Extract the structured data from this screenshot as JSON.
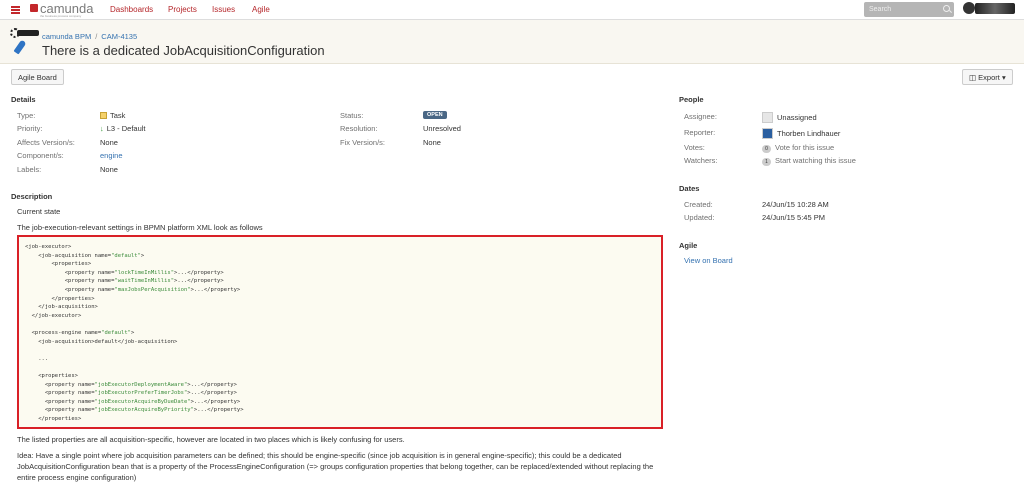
{
  "topbar": {
    "logo_text": "camunda",
    "logo_sub": "the business process company",
    "nav": [
      "Dashboards",
      "Projects",
      "Issues",
      "Agile"
    ],
    "search_placeholder": "Search"
  },
  "header": {
    "breadcrumb": [
      "camunda BPM",
      "CAM-4135"
    ],
    "title": "There is a dedicated JobAcquisitionConfiguration"
  },
  "toolbar": {
    "agile_board": "Agile Board",
    "export": "Export"
  },
  "details": {
    "heading": "Details",
    "type_label": "Type:",
    "type_value": "Task",
    "priority_label": "Priority:",
    "priority_value": "L3 - Default",
    "affects_label": "Affects Version/s:",
    "affects_value": "None",
    "component_label": "Component/s:",
    "component_value": "engine",
    "labels_label": "Labels:",
    "labels_value": "None",
    "status_label": "Status:",
    "status_value": "OPEN",
    "resolution_label": "Resolution:",
    "resolution_value": "Unresolved",
    "fix_label": "Fix Version/s:",
    "fix_value": "None"
  },
  "people": {
    "heading": "People",
    "assignee_label": "Assignee:",
    "assignee_value": "Unassigned",
    "reporter_label": "Reporter:",
    "reporter_value": "Thorben Lindhauer",
    "votes_label": "Votes:",
    "votes_count": "0",
    "votes_value": "Vote for this issue",
    "watchers_label": "Watchers:",
    "watchers_count": "1",
    "watchers_value": "Start watching this issue"
  },
  "dates": {
    "heading": "Dates",
    "created_label": "Created:",
    "created_value": "24/Jun/15 10:28 AM",
    "updated_label": "Updated:",
    "updated_value": "24/Jun/15 5:45 PM"
  },
  "agile": {
    "heading": "Agile",
    "link": "View on Board"
  },
  "description": {
    "heading": "Description",
    "p1": "Current state",
    "p2": "The job-execution-relevant settings in BPMN platform XML look as follows",
    "p3": "The listed properties are all acquisition-specific, however are located in two places which is likely confusing for users.",
    "p4_line1": "Idea: Have a single point where job acquisition parameters can be defined; this should be engine-specific (since job acquisition is in general engine-specific); this could be a dedicated",
    "p4_line2": "JobAcquisitionConfiguration bean that is a property of the ProcessEngineConfiguration (=> groups configuration properties that belong together, can be replaced/extended without replacing the",
    "p4_line3": "entire process engine configuration)"
  },
  "code_lines": [
    "<job-executor>",
    "    <job-acquisition name=\"default\">",
    "        <properties>",
    "            <property name=\"lockTimeInMillis\">...</property>",
    "            <property name=\"waitTimeInMillis\">...</property>",
    "            <property name=\"maxJobsPerAcquisition\">...</property>",
    "        </properties>",
    "    </job-acquisition>",
    "  </job-executor>",
    "",
    "  <process-engine name=\"default\">",
    "    <job-acquisition>default</job-acquisition>",
    "",
    "    ...",
    "",
    "    <properties>",
    "      <property name=\"jobExecutorDeploymentAware\">...</property>",
    "      <property name=\"jobExecutorPreferTimerJobs\">...</property>",
    "      <property name=\"jobExecutorAcquireByDueDate\">...</property>",
    "      <property name=\"jobExecutorAcquireByPriority\">...</property>",
    "    </properties>"
  ]
}
